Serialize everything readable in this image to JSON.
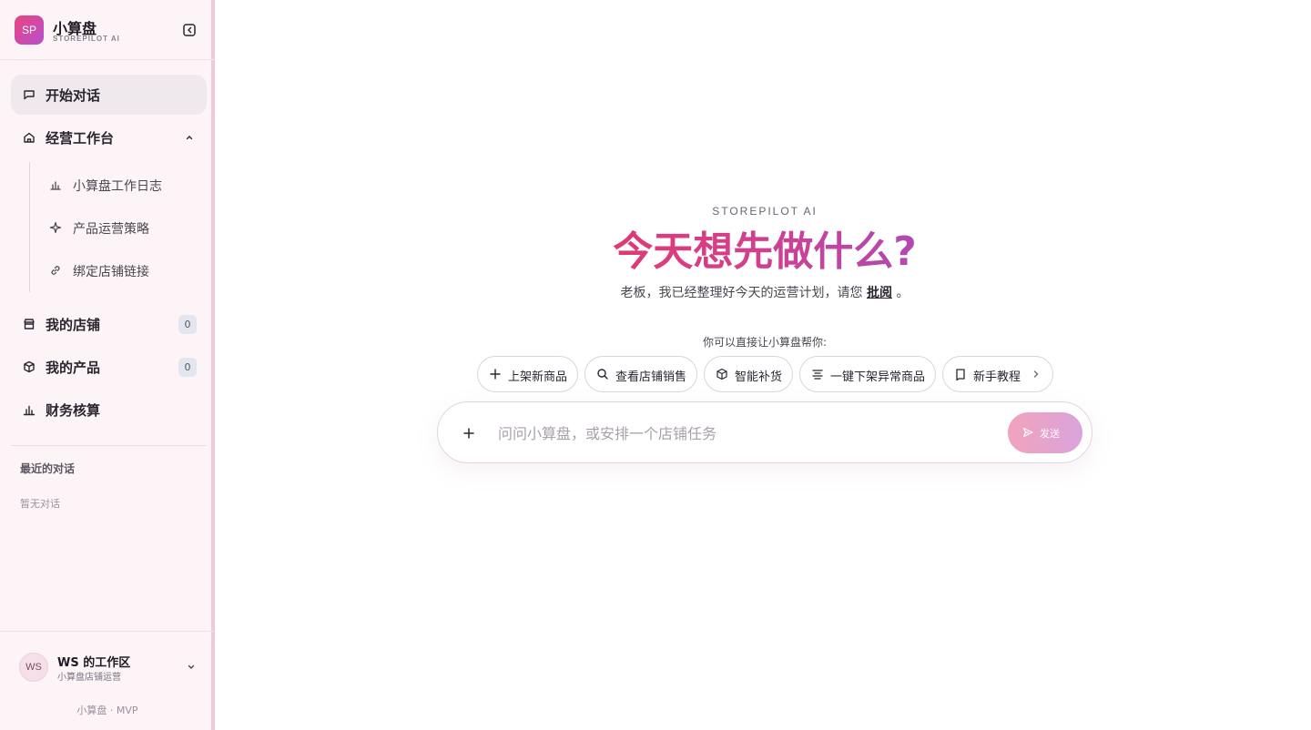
{
  "brand": {
    "logo": "SP",
    "name": "小算盘",
    "subtitle": "STOREPILOT AI"
  },
  "nav": {
    "start_chat": "开始对话",
    "workbench": "经营工作台",
    "sub_items": [
      {
        "label": "小算盘工作日志",
        "icon": "bar-chart-icon"
      },
      {
        "label": "产品运营策略",
        "icon": "sparkle-icon"
      },
      {
        "label": "绑定店铺链接",
        "icon": "link-icon"
      }
    ],
    "my_stores": {
      "label": "我的店铺",
      "count": "0"
    },
    "my_products": {
      "label": "我的产品",
      "count": "0"
    },
    "finance": "财务核算"
  },
  "recent": {
    "title": "最近的对话",
    "empty": "暂无对话"
  },
  "workspace": {
    "avatar": "WS",
    "name": "WS 的工作区",
    "subtitle": "小算盘店铺运营",
    "version": "小算盘 · MVP"
  },
  "main": {
    "eyebrow": "STOREPILOT AI",
    "headline": "今天想先做什么?",
    "subline_prefix": "老板，我已经整理好今天的运营计划，请您",
    "subline_link": "批阅",
    "subline_suffix": "。",
    "hint": "你可以直接让小算盘帮你:",
    "chips": [
      {
        "label": "上架新商品",
        "icon": "plus-icon"
      },
      {
        "label": "查看店铺销售",
        "icon": "search-icon"
      },
      {
        "label": "智能补货",
        "icon": "box-icon"
      },
      {
        "label": "一键下架异常商品",
        "icon": "align-center-icon"
      },
      {
        "label": "新手教程",
        "icon": "book-icon"
      }
    ],
    "composer": {
      "placeholder": "问问小算盘，或安排一个店铺任务",
      "send_label": "发送"
    }
  },
  "colors": {
    "accent_pink": "#e8365f",
    "accent_purple": "#9b4fd0",
    "sidebar_bg": "#fdf4f7"
  }
}
